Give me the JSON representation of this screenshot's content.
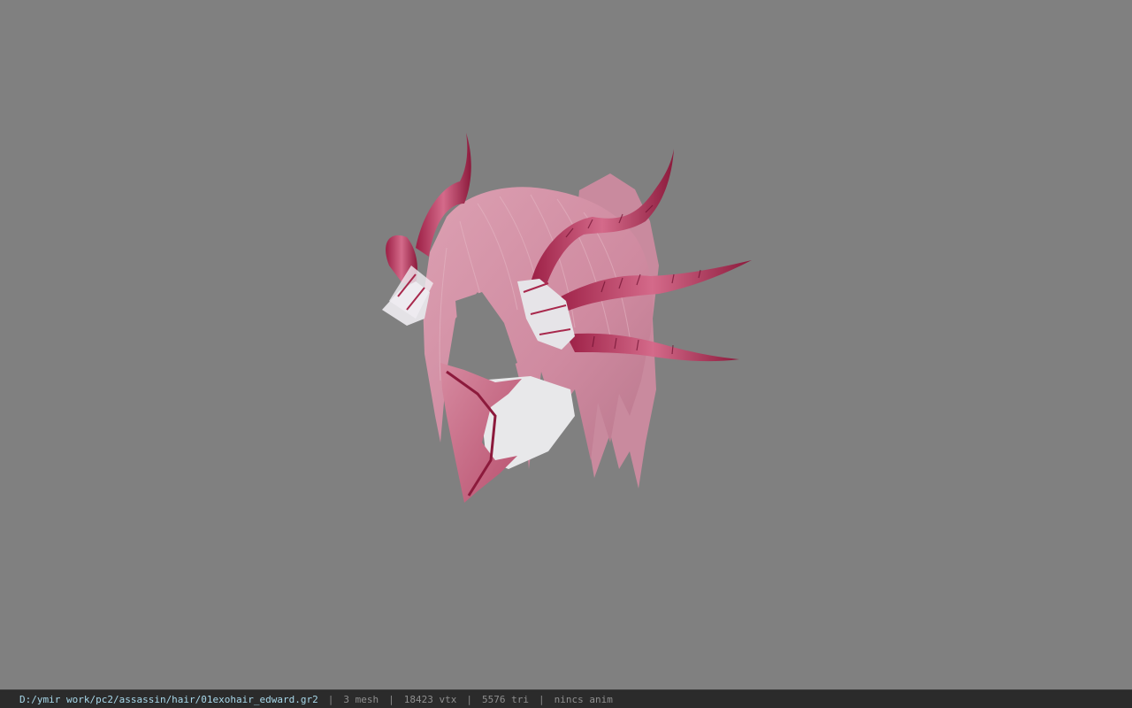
{
  "status_bar": {
    "file_path": "D:/ymir work/pc2/assassin/hair/01exohair_edward.gr2",
    "separator": "|",
    "mesh_count": "3 mesh",
    "vertex_count": "18423 vtx",
    "triangle_count": "5576 tri",
    "animation": "nincs anim"
  },
  "viewport": {
    "background_color": "#808080",
    "model_primary_color": "#d48fa4",
    "model_accent_color": "#a8284c"
  }
}
